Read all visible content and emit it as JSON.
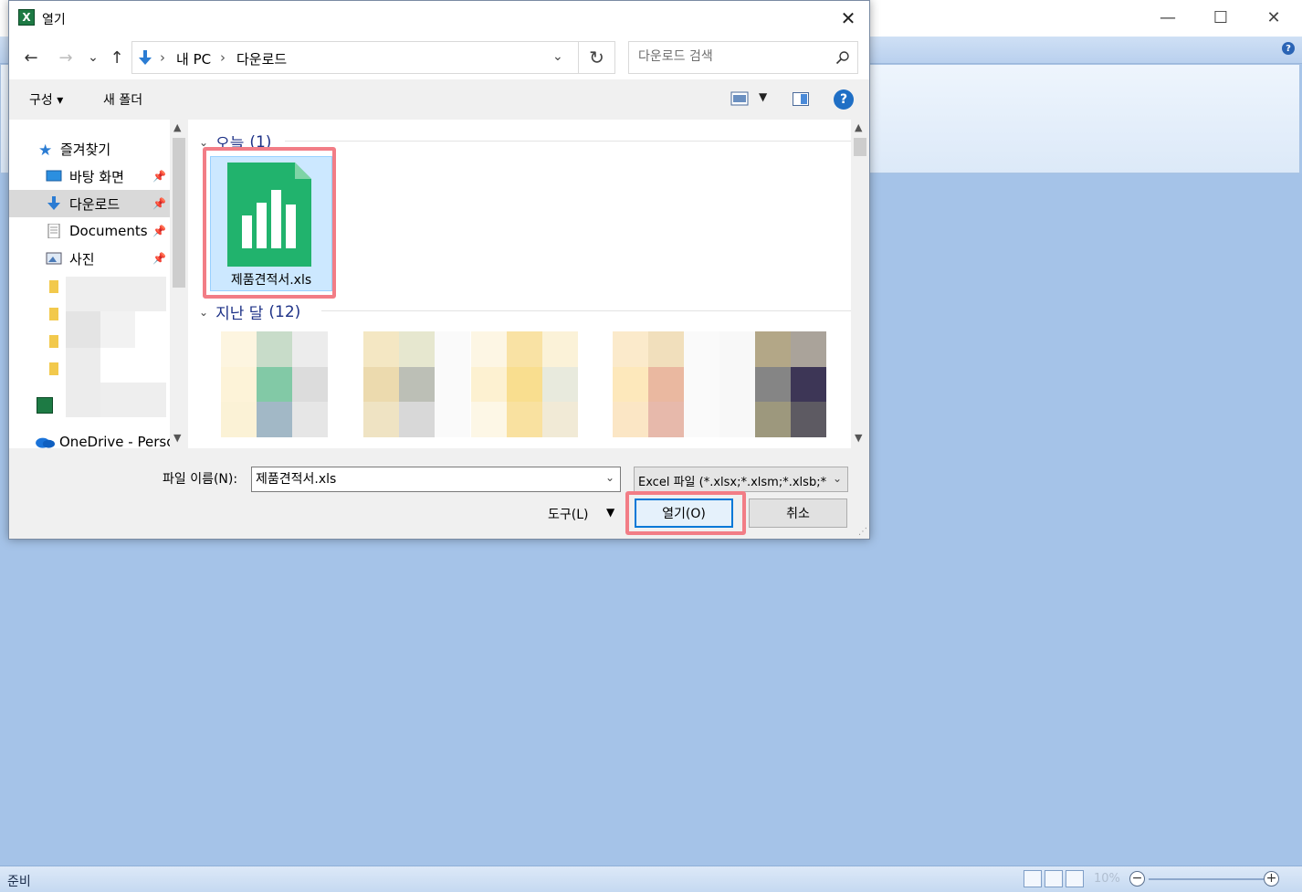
{
  "dialog": {
    "title": "열기",
    "nav": {
      "back": "←",
      "forward": "→",
      "recent": "⌄",
      "up": "↑"
    },
    "address": {
      "crumbs": [
        "내 PC",
        "다운로드"
      ]
    },
    "search": {
      "placeholder": "다운로드 검색"
    },
    "toolbar": {
      "organize": "구성 ▾",
      "new_folder": "새 폴더"
    },
    "nav_pane": {
      "quick_access": "즐겨찾기",
      "items": [
        {
          "label": "바탕 화면",
          "icon": "desktop-icon"
        },
        {
          "label": "다운로드",
          "icon": "download-icon",
          "selected": true
        },
        {
          "label": "Documents",
          "icon": "documents-icon"
        },
        {
          "label": "사진",
          "icon": "pictures-icon"
        }
      ],
      "onedrive": "OneDrive - Persor"
    },
    "content": {
      "groups": [
        {
          "name": "오늘",
          "count": "(1)"
        },
        {
          "name": "지난 달",
          "count": "(12)"
        }
      ],
      "selected_file": "제품견적서.xls"
    },
    "filename_label": "파일 이름(N):",
    "filename_value": "제품견적서.xls",
    "filetype_value": "Excel 파일 (*.xlsx;*.xlsm;*.xlsb;*.xlam;*.xls)",
    "tools_label": "도구(L)",
    "open_label": "열기(O)",
    "cancel_label": "취소"
  },
  "app": {
    "status": "준비",
    "zoom": "10%"
  },
  "colors": {
    "accent": "#0078d7",
    "highlight": "#f27d86",
    "excel_green": "#21a366",
    "selection": "#cce8ff",
    "group_header": "#1e3287"
  }
}
